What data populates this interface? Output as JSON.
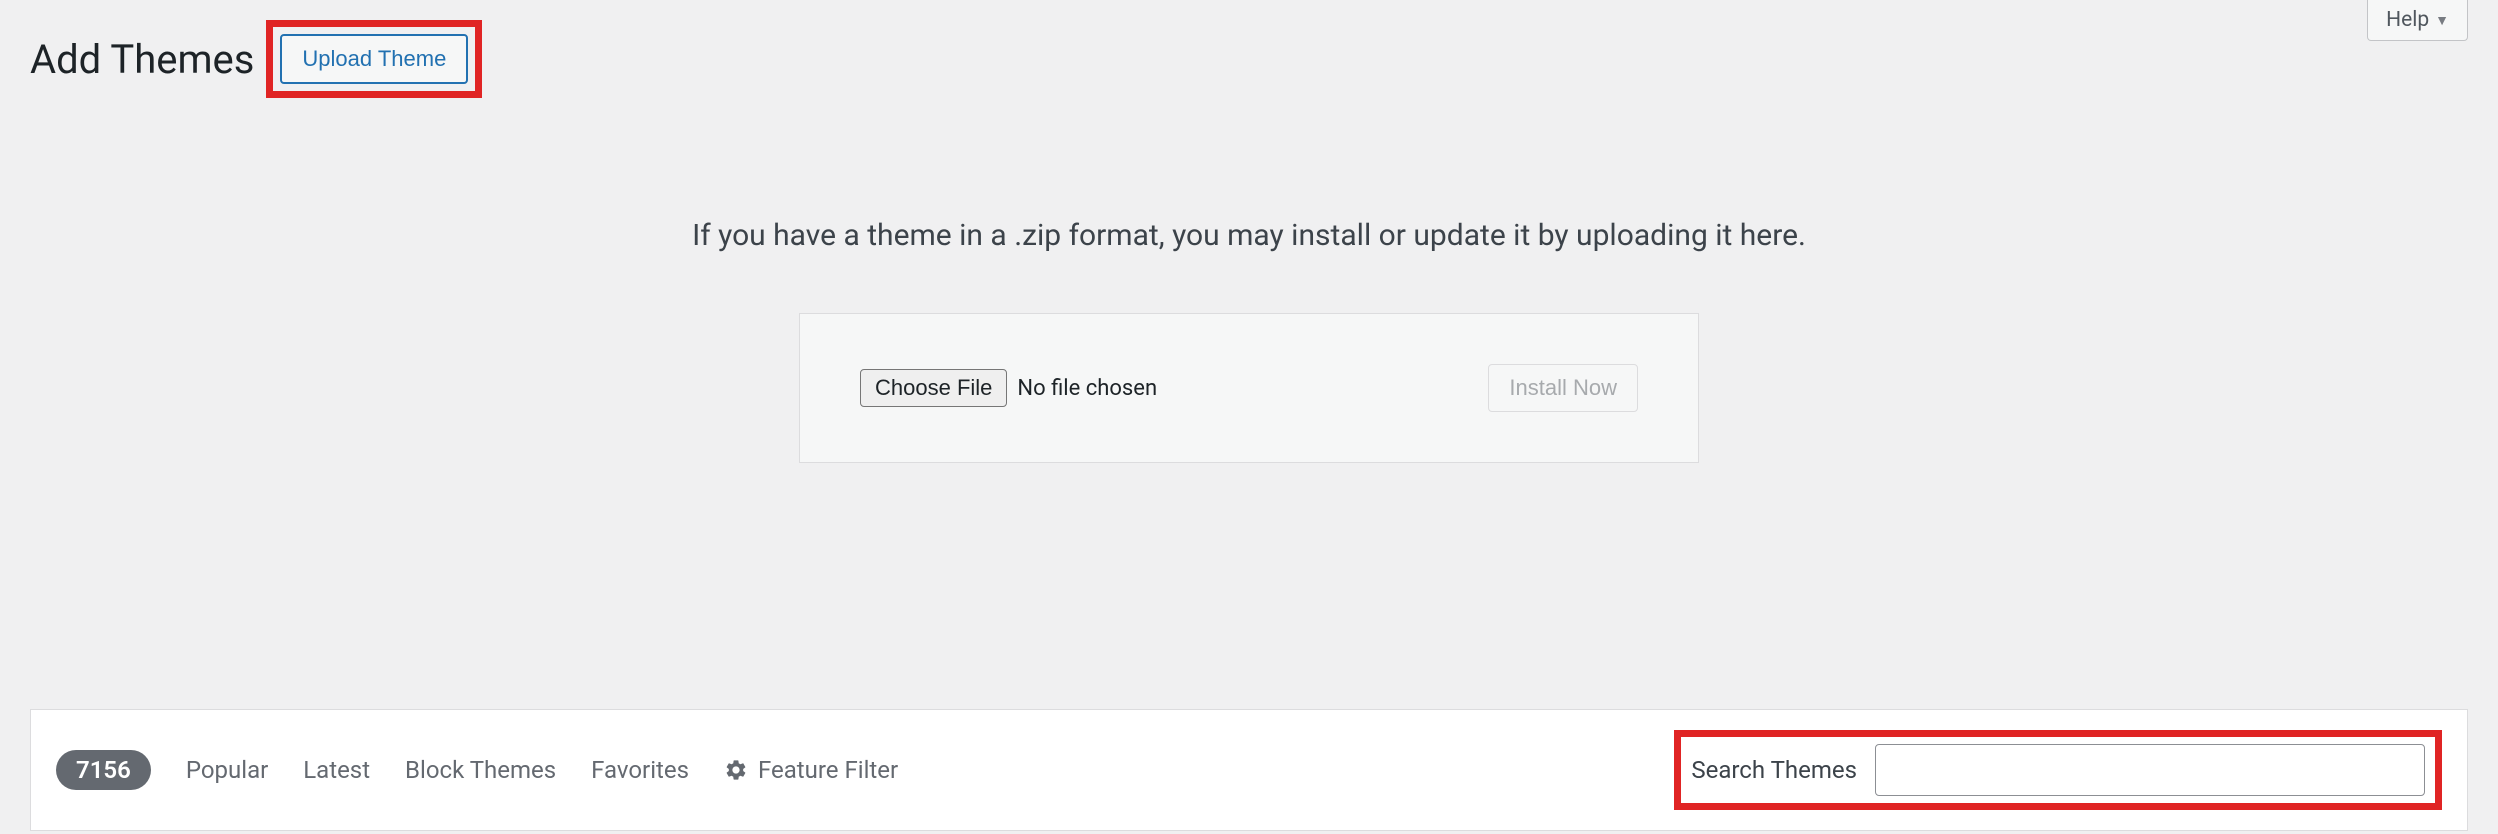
{
  "help": {
    "label": "Help"
  },
  "header": {
    "title": "Add Themes",
    "upload_button": "Upload Theme"
  },
  "upload": {
    "instruction": "If you have a theme in a .zip format, you may install or update it by uploading it here.",
    "choose_file": "Choose File",
    "no_file": "No file chosen",
    "install_now": "Install Now"
  },
  "filter_bar": {
    "count": "7156",
    "tabs": {
      "popular": "Popular",
      "latest": "Latest",
      "block_themes": "Block Themes",
      "favorites": "Favorites",
      "feature_filter": "Feature Filter"
    },
    "search_label": "Search Themes",
    "search_value": ""
  }
}
